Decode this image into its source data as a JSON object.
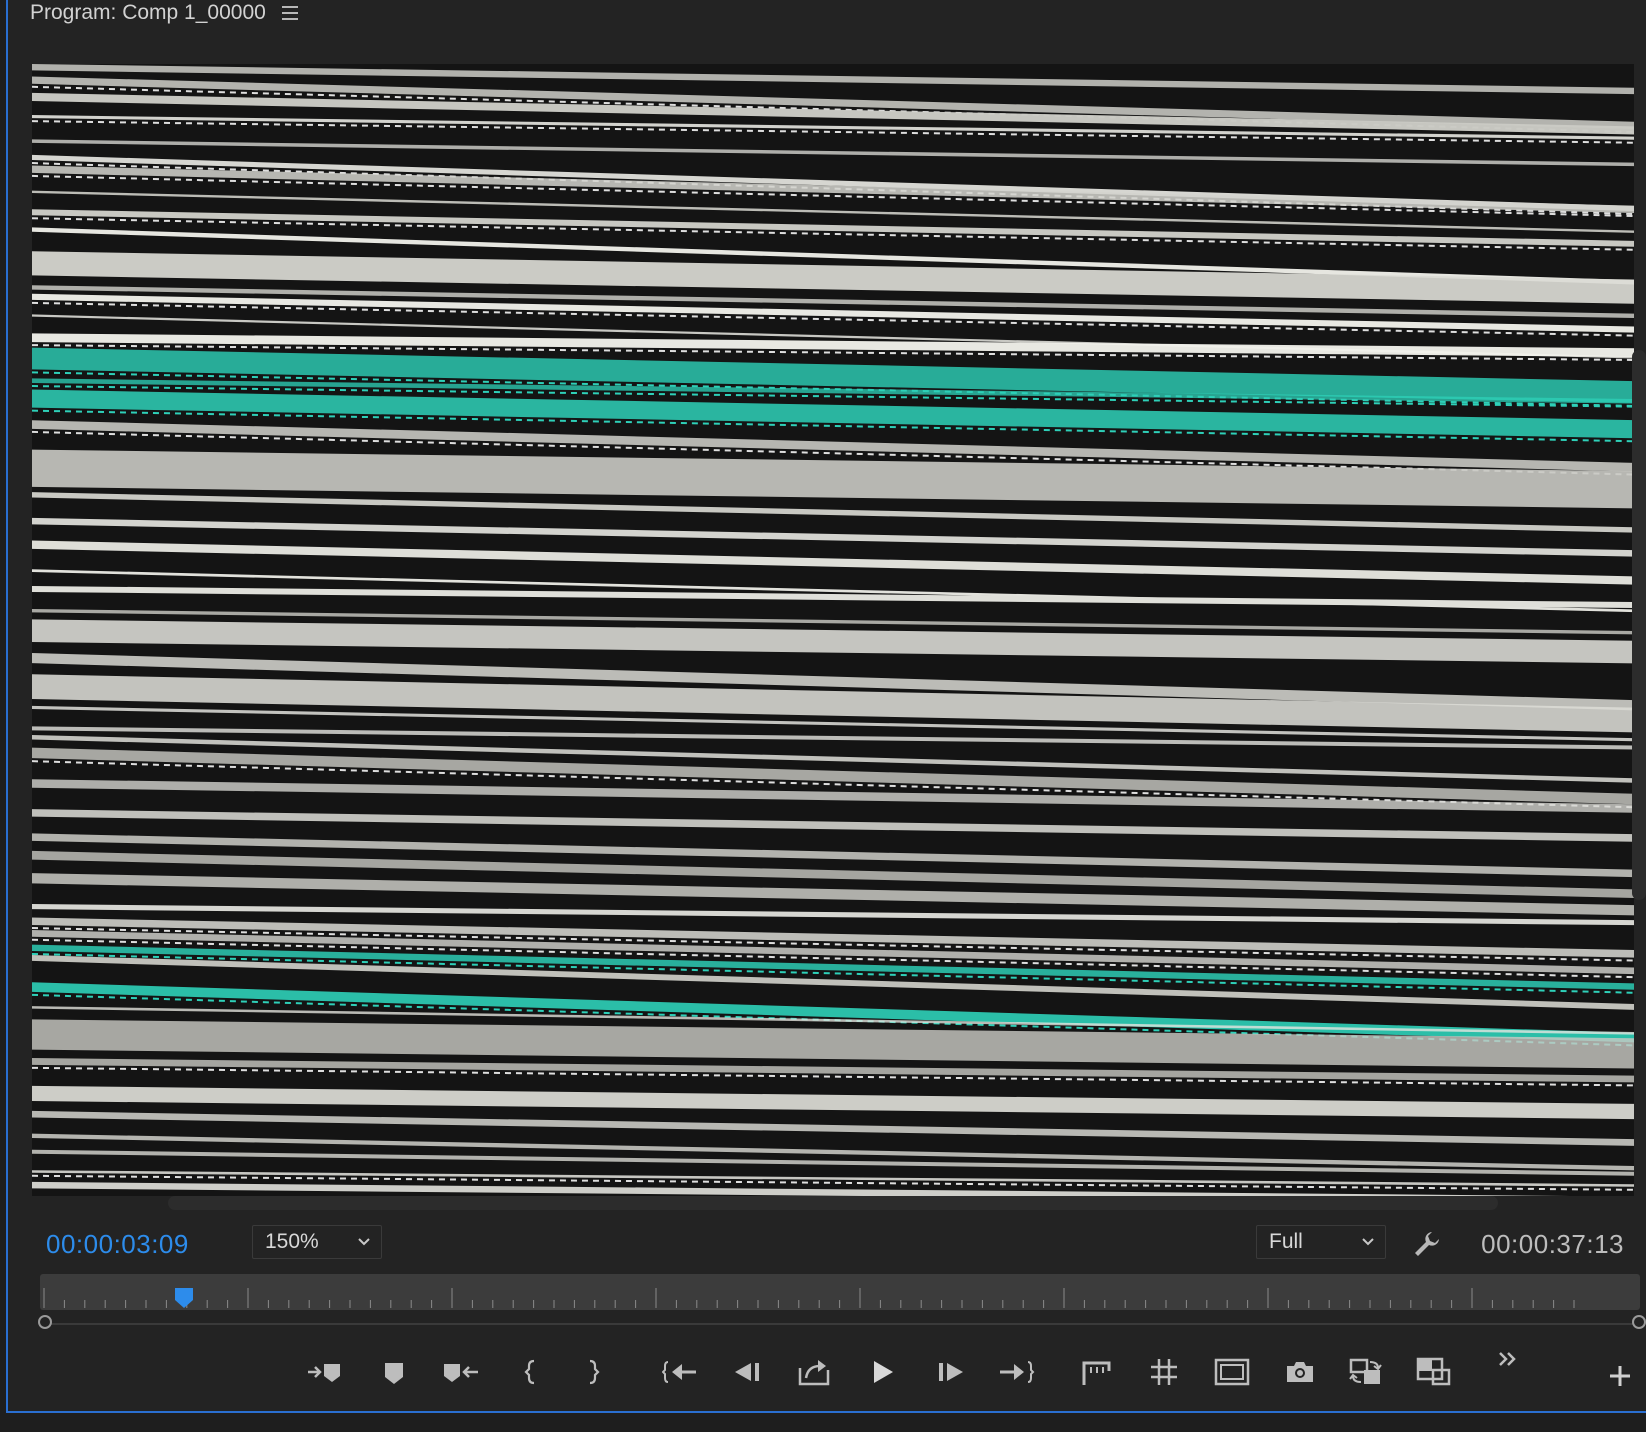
{
  "panel": {
    "title": "Program: Comp 1_00000",
    "menu_icon": "hamburger-menu-icon"
  },
  "viewer": {
    "content": "glitch video frame with white, black and teal horizontal streaks"
  },
  "controls": {
    "current_timecode": "00:00:03:09",
    "zoom_level": "150%",
    "playback_resolution": "Full",
    "settings_icon": "wrench-icon",
    "duration_timecode": "00:00:37:13"
  },
  "timeline": {
    "playhead_position": 0.09,
    "accent_color": "#2d8ceb"
  },
  "transport": {
    "buttons": [
      {
        "name": "mark-in-icon",
        "tooltip": "Mark In"
      },
      {
        "name": "add-marker-icon",
        "tooltip": "Add Marker"
      },
      {
        "name": "mark-out-icon",
        "tooltip": "Mark Out"
      },
      {
        "name": "go-to-in-icon",
        "tooltip": "Go to In"
      },
      {
        "name": "go-to-out-icon",
        "tooltip": "Go to Out"
      },
      {
        "name": "go-to-previous-edit-icon",
        "tooltip": "Go to Previous Edit Point"
      },
      {
        "name": "step-back-icon",
        "tooltip": "Step Back 1 Frame"
      },
      {
        "name": "loop-icon",
        "tooltip": "Loop"
      },
      {
        "name": "play-icon",
        "tooltip": "Play-Stop Toggle"
      },
      {
        "name": "step-forward-icon",
        "tooltip": "Step Forward 1 Frame"
      },
      {
        "name": "go-to-next-edit-icon",
        "tooltip": "Go to Next Edit Point"
      },
      {
        "name": "lift-icon",
        "tooltip": "Lift"
      },
      {
        "name": "safe-margins-icon",
        "tooltip": "Safe Margins"
      },
      {
        "name": "comparison-view-icon",
        "tooltip": "Comparison View"
      },
      {
        "name": "export-frame-icon",
        "tooltip": "Export Frame"
      },
      {
        "name": "toggle-proxies-icon",
        "tooltip": "Toggle Proxies"
      },
      {
        "name": "vr-video-icon",
        "tooltip": "VR Video"
      },
      {
        "name": "more-controls-icon",
        "tooltip": "More"
      },
      {
        "name": "button-editor-icon",
        "tooltip": "Button Editor"
      }
    ]
  },
  "colors": {
    "panel_bg": "#232323",
    "accent_blue": "#2d8ceb",
    "teal_streak": "#2ed0b8"
  }
}
